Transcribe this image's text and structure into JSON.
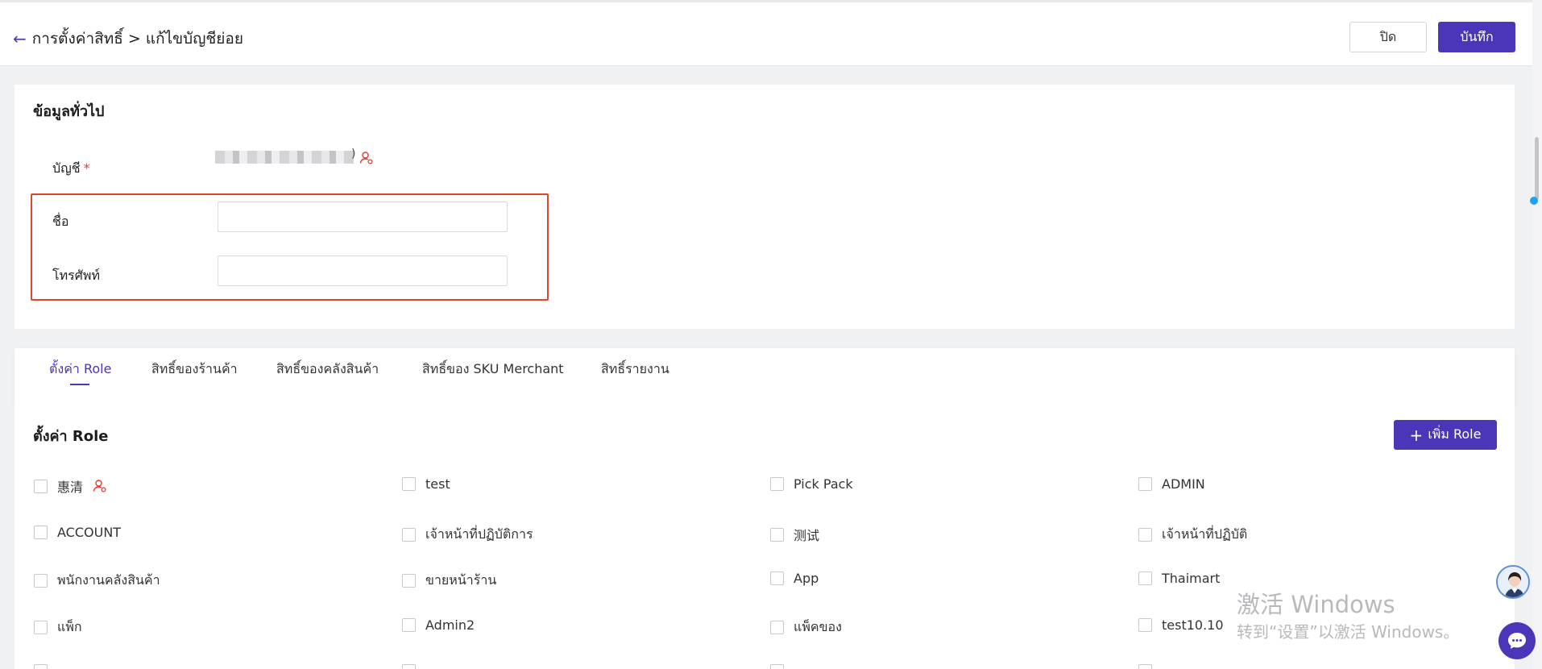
{
  "header": {
    "back_icon": "arrow-left-icon",
    "breadcrumb": "การตั้งค่าสิทธิ์ > แก้ไขบัญชีย่อย",
    "close_label": "ปิด",
    "save_label": "บันทึก"
  },
  "general": {
    "title": "ข้อมูลทั่วไป",
    "account_label": "บัญชี",
    "required_mark": "*",
    "account_value_suffix": ")",
    "name_label": "ชื่อ",
    "name_value": "",
    "phone_label": "โทรศัพท์",
    "phone_value": ""
  },
  "tabs": [
    {
      "label": "ตั้งค่า Role",
      "active": true
    },
    {
      "label": "สิทธิ์ของร้านค้า",
      "active": false
    },
    {
      "label": "สิทธิ์ของคลังสินค้า",
      "active": false
    },
    {
      "label": "สิทธิ์ของ SKU Merchant",
      "active": false
    },
    {
      "label": "สิทธิ์รายงาน",
      "active": false
    }
  ],
  "roles": {
    "title": "ตั้งค่า Role",
    "add_label": "เพิ่ม Role",
    "items": [
      [
        "惠清",
        "test",
        "Pick Pack",
        "ADMIN"
      ],
      [
        "ACCOUNT",
        "เจ้าหน้าที่ปฏิบัติการ",
        "测试",
        "เจ้าหน้าที่ปฏิบัติ"
      ],
      [
        "พนักงานคลังสินค้า",
        "ขายหน้าร้าน",
        "App",
        "Thaimart"
      ],
      [
        "แพ็ก",
        "Admin2",
        "แพ็คของ",
        "test10.10"
      ]
    ]
  },
  "watermark": {
    "line1": "激活 Windows",
    "line2": "转到“设置”以激活 Windows。"
  },
  "colors": {
    "primary": "#4b35b8",
    "highlight": "#e2452c",
    "required": "#e53935"
  }
}
